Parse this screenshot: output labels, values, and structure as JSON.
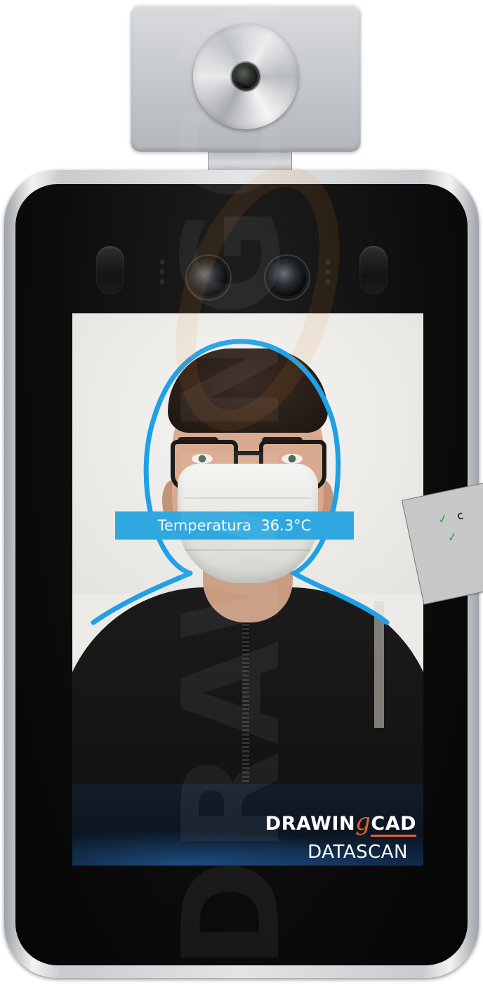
{
  "screen": {
    "temperature_label": "Temperatura  36.3°C",
    "brand_logo": {
      "word_start": "DRAWIN",
      "letter_g": "g",
      "word_end": "CAD"
    },
    "product_name": "DATASCAN"
  },
  "watermark": {
    "text": "DRAWINGCAD"
  },
  "note_card": {
    "items": [
      {
        "icon": "check-icon",
        "text": "c"
      },
      {
        "icon": "check-icon",
        "text": ""
      }
    ]
  },
  "colors": {
    "temperature_bar": "#2fa8e0",
    "face_guide": "#1ea1e6",
    "logo_accent": "#e9602a",
    "check": "#3aa83a"
  }
}
